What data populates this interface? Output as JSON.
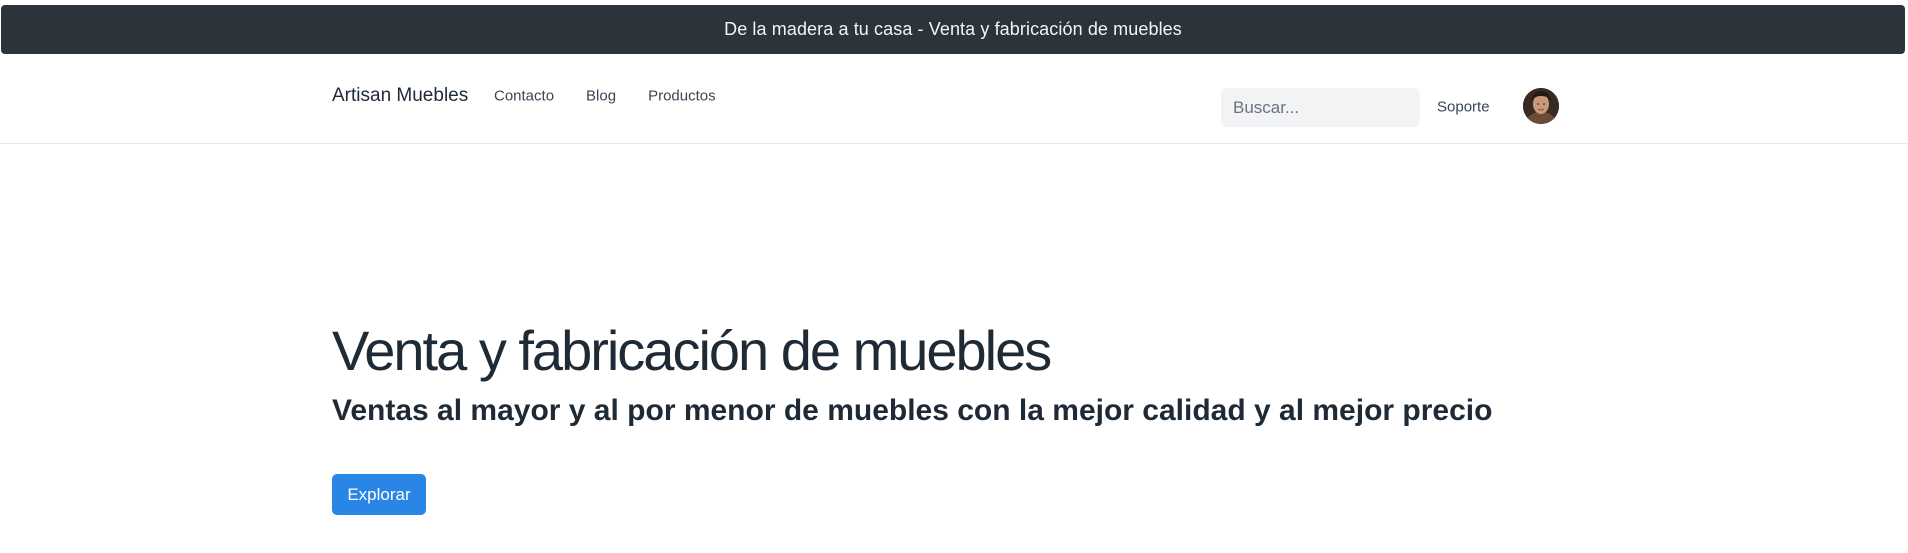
{
  "banner": {
    "text": "De la madera a tu casa - Venta y fabricación de muebles"
  },
  "navbar": {
    "brand": "Artisan Muebles",
    "links": [
      {
        "label": "Contacto"
      },
      {
        "label": "Blog"
      },
      {
        "label": "Productos"
      }
    ],
    "search": {
      "placeholder": "Buscar...",
      "value": ""
    },
    "support_label": "Soporte",
    "avatar_icon": "user-avatar-photo"
  },
  "hero": {
    "title": "Venta y fabricación de muebles",
    "subtitle": "Ventas al mayor y al por menor de muebles con la mejor calidad y al mejor precio",
    "cta_label": "Explorar"
  },
  "colors": {
    "banner_bg": "#2c333b",
    "primary": "#2a86e6",
    "text_dark": "#1f2a37",
    "search_bg": "#f2f3f5"
  }
}
